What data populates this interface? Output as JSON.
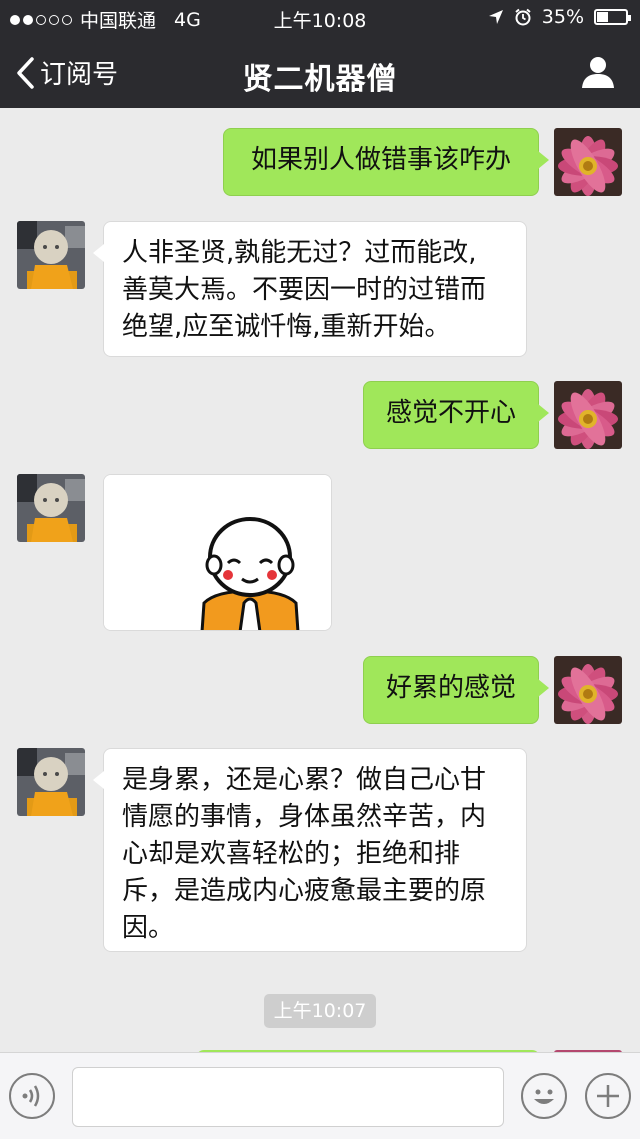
{
  "status_bar": {
    "carrier": "中国联通",
    "network": "4G",
    "time": "上午10:08",
    "battery_percent": "35%",
    "battery_level": 0.35,
    "signal_bars_filled": 2,
    "signal_bars_total": 5
  },
  "nav": {
    "back_label": "订阅号",
    "title": "贤二机器僧",
    "profile_icon": "person-icon"
  },
  "messages": [
    {
      "side": "right",
      "type": "text",
      "text": "如果别人做错事该咋办"
    },
    {
      "side": "left",
      "type": "text",
      "lines": [
        "人非圣贤,孰能无过？过而能改,",
        "善莫大焉。不要因一时的过错而",
        "绝望,应至诚忏悔,重新开始。"
      ]
    },
    {
      "side": "right",
      "type": "text",
      "text": "感觉不开心"
    },
    {
      "side": "left",
      "type": "image",
      "image": "monk-cartoon-sticker"
    },
    {
      "side": "right",
      "type": "text",
      "text": "好累的感觉"
    },
    {
      "side": "left",
      "type": "text",
      "lines": [
        "是身累，还是心累？做自己心甘",
        "情愿的事情，身体虽然辛苦，内",
        "心却是欢喜轻松的；拒绝和排",
        "斥，是造成内心疲惫最主要的原",
        "因。"
      ]
    }
  ],
  "timestamp": "上午10:07",
  "input_bar": {
    "voice_icon": "voice-icon",
    "emoji_icon": "emoji-icon",
    "plus_icon": "plus-icon",
    "input_value": ""
  },
  "colors": {
    "header_bg": "#2b2b2f",
    "chat_bg": "#ebebeb",
    "outgoing_bubble": "#a0e75a",
    "incoming_bubble": "#ffffff"
  }
}
